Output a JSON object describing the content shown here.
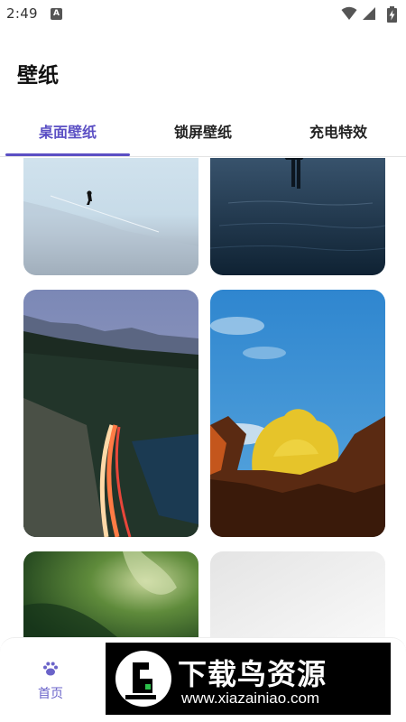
{
  "status_bar": {
    "time": "2:49",
    "notification_icon": "A",
    "icons": [
      "wifi-icon",
      "signal-icon",
      "battery-charging-icon"
    ]
  },
  "header": {
    "title": "壁纸"
  },
  "tabs": [
    {
      "label": "桌面壁纸",
      "active": true
    },
    {
      "label": "锁屏壁纸",
      "active": false
    },
    {
      "label": "充电特效",
      "active": false
    }
  ],
  "wallpapers": [
    "wallpaper-person-on-snow-ridge",
    "wallpaper-reflection-on-lake",
    "wallpaper-mountain-highway-light-trails",
    "wallpaper-yellow-tree-blue-sky",
    "wallpaper-green-foliage",
    "wallpaper-white-gradient"
  ],
  "bottom_nav": {
    "home_label": "首页",
    "home_icon": "paw-icon"
  },
  "watermark": {
    "title": "下载鸟资源",
    "url": "www.xiazainiao.com"
  },
  "colors": {
    "accent": "#5b4fc4",
    "nav_active": "#6a63c9"
  }
}
